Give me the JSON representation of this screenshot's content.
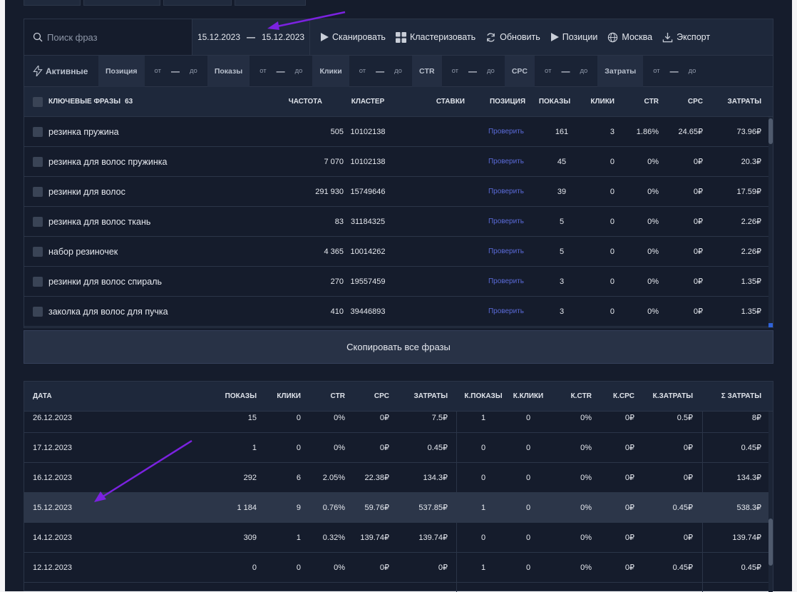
{
  "toolbar": {
    "search_placeholder": "Поиск фраз",
    "date_from": "15.12.2023",
    "date_to": "15.12.2023",
    "date_sep": "—",
    "scan": "Сканировать",
    "cluster": "Кластеризовать",
    "refresh": "Обновить",
    "positions": "Позиции",
    "region": "Москва",
    "export": "Экспорт"
  },
  "filters": {
    "active": "Активные",
    "from": "от",
    "to": "до",
    "dash": "—",
    "items": [
      "Позиция",
      "Показы",
      "Клики",
      "CTR",
      "CPC",
      "Затраты"
    ]
  },
  "keywords": {
    "header": {
      "phrases": "КЛЮЧЕВЫЕ ФРАЗЫ",
      "count": "63",
      "freq": "ЧАСТОТА",
      "cluster": "КЛАСТЕР",
      "bids": "СТАВКИ",
      "position": "ПОЗИЦИЯ",
      "impressions": "ПОКАЗЫ",
      "clicks": "КЛИКИ",
      "ctr": "CTR",
      "cpc": "CPC",
      "cost": "ЗАТРАТЫ"
    },
    "check_label": "Проверить",
    "rows": [
      {
        "phrase": "резинка пружина",
        "freq": "505",
        "cluster": "10102138",
        "impressions": "161",
        "clicks": "3",
        "ctr": "1.86%",
        "cpc": "24.65₽",
        "cost": "73.96₽"
      },
      {
        "phrase": "резинка для волос пружинка",
        "freq": "7 070",
        "cluster": "10102138",
        "impressions": "45",
        "clicks": "0",
        "ctr": "0%",
        "cpc": "0₽",
        "cost": "20.3₽"
      },
      {
        "phrase": "резинки для волос",
        "freq": "291 930",
        "cluster": "15749646",
        "impressions": "39",
        "clicks": "0",
        "ctr": "0%",
        "cpc": "0₽",
        "cost": "17.59₽"
      },
      {
        "phrase": "резинка для волос ткань",
        "freq": "83",
        "cluster": "31184325",
        "impressions": "5",
        "clicks": "0",
        "ctr": "0%",
        "cpc": "0₽",
        "cost": "2.26₽"
      },
      {
        "phrase": "набор резиночек",
        "freq": "4 365",
        "cluster": "10014262",
        "impressions": "5",
        "clicks": "0",
        "ctr": "0%",
        "cpc": "0₽",
        "cost": "2.26₽"
      },
      {
        "phrase": "резинки для волос спираль",
        "freq": "270",
        "cluster": "19557459",
        "impressions": "3",
        "clicks": "0",
        "ctr": "0%",
        "cpc": "0₽",
        "cost": "1.35₽"
      },
      {
        "phrase": "заколка для волос для пучка",
        "freq": "410",
        "cluster": "39446893",
        "impressions": "3",
        "clicks": "0",
        "ctr": "0%",
        "cpc": "0₽",
        "cost": "1.35₽"
      }
    ]
  },
  "copy_all": "Скопировать все фразы",
  "stats": {
    "header": {
      "date": "ДАТА",
      "impressions": "ПОКАЗЫ",
      "clicks": "КЛИКИ",
      "ctr": "CTR",
      "cpc": "CPC",
      "cost": "ЗАТРАТЫ",
      "k_impressions": "К.ПОКАЗЫ",
      "k_clicks": "К.КЛИКИ",
      "k_ctr": "К.CTR",
      "k_cpc": "К.CPC",
      "k_cost": "К.ЗАТРАТЫ",
      "total_cost": "Σ ЗАТРАТЫ"
    },
    "rows": [
      {
        "date": "26.12.2023",
        "impressions": "15",
        "clicks": "0",
        "ctr": "0%",
        "cpc": "0₽",
        "cost": "7.5₽",
        "k_impressions": "1",
        "k_clicks": "0",
        "k_ctr": "0%",
        "k_cpc": "0₽",
        "k_cost": "0.5₽",
        "total": "8₽"
      },
      {
        "date": "17.12.2023",
        "impressions": "1",
        "clicks": "0",
        "ctr": "0%",
        "cpc": "0₽",
        "cost": "0.45₽",
        "k_impressions": "0",
        "k_clicks": "0",
        "k_ctr": "0%",
        "k_cpc": "0₽",
        "k_cost": "0₽",
        "total": "0.45₽"
      },
      {
        "date": "16.12.2023",
        "impressions": "292",
        "clicks": "6",
        "ctr": "2.05%",
        "cpc": "22.38₽",
        "cost": "134.3₽",
        "k_impressions": "0",
        "k_clicks": "0",
        "k_ctr": "0%",
        "k_cpc": "0₽",
        "k_cost": "0₽",
        "total": "134.3₽"
      },
      {
        "date": "15.12.2023",
        "impressions": "1 184",
        "clicks": "9",
        "ctr": "0.76%",
        "cpc": "59.76₽",
        "cost": "537.85₽",
        "k_impressions": "1",
        "k_clicks": "0",
        "k_ctr": "0%",
        "k_cpc": "0₽",
        "k_cost": "0.45₽",
        "total": "538.3₽"
      },
      {
        "date": "14.12.2023",
        "impressions": "309",
        "clicks": "1",
        "ctr": "0.32%",
        "cpc": "139.74₽",
        "cost": "139.74₽",
        "k_impressions": "0",
        "k_clicks": "0",
        "k_ctr": "0%",
        "k_cpc": "0₽",
        "k_cost": "0₽",
        "total": "139.74₽"
      },
      {
        "date": "12.12.2023",
        "impressions": "0",
        "clicks": "0",
        "ctr": "0%",
        "cpc": "0₽",
        "cost": "0₽",
        "k_impressions": "1",
        "k_clicks": "0",
        "k_ctr": "0%",
        "k_cpc": "0₽",
        "k_cost": "0.45₽",
        "total": "0.45₽"
      }
    ]
  },
  "icons": [
    "search-icon",
    "play-icon",
    "grid-icon",
    "refresh-icon",
    "globe-icon",
    "download-icon",
    "lightning-icon"
  ],
  "colors": {
    "accent": "#5a6ad8",
    "background": "#151c2c",
    "arrow": "#7b22e0"
  }
}
